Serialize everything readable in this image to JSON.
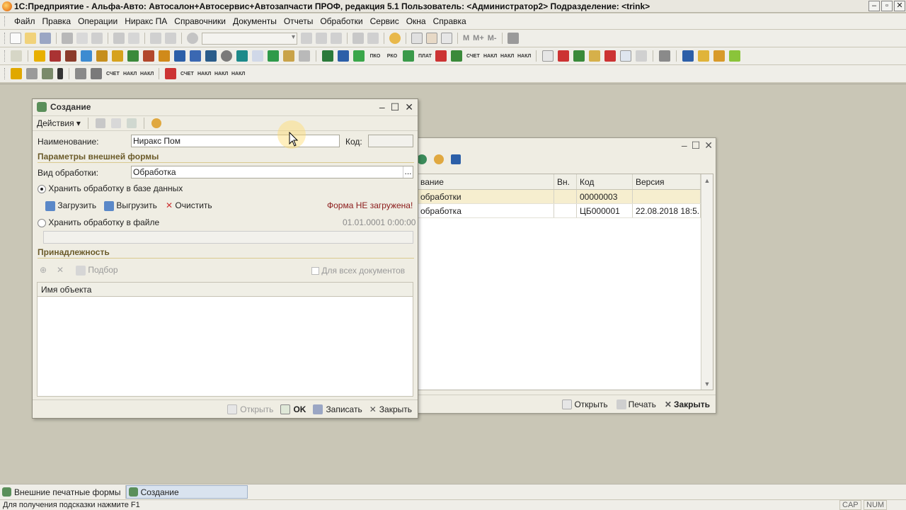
{
  "window": {
    "title": "1С:Предприятие - Альфа-Авто: Автосалон+Автосервис+Автозапчасти ПРОФ, редакция 5.1     Пользователь: <Администратор2>     Подразделение: <trink>"
  },
  "menu": [
    "Файл",
    "Правка",
    "Операции",
    "Ниракс ПА",
    "Справочники",
    "Документы",
    "Отчеты",
    "Обработки",
    "Сервис",
    "Окна",
    "Справка"
  ],
  "toolbar": {
    "m_labels": [
      "M",
      "M+",
      "M-"
    ],
    "doc_labels": [
      "ПКО",
      "РКО",
      "ПЛАТ",
      "СЧЕТ",
      "НАКЛ",
      "НАКЛ",
      "НАКЛ",
      "СЧЕТ",
      "НАКЛ",
      "НАКЛ",
      "НАКЛ"
    ]
  },
  "back_window": {
    "columns": [
      "вание",
      "Вн.",
      "Код",
      "Версия"
    ],
    "rows": [
      {
        "name": "обработки",
        "vn": "",
        "code": "00000003",
        "version": ""
      },
      {
        "name": "обработка",
        "vn": "",
        "code": "ЦБ000001",
        "version": "22.08.2018 18:5..."
      }
    ],
    "buttons": {
      "open": "Открыть",
      "print": "Печать",
      "close": "Закрыть"
    }
  },
  "dialog": {
    "title": "Создание",
    "actions": "Действия",
    "name_label": "Наименование:",
    "name_value": "Ниракс Пом",
    "code_label": "Код:",
    "code_value": "",
    "section_params": "Параметры внешней формы",
    "kind_label": "Вид обработки:",
    "kind_value": "Обработка",
    "radio_db": "Хранить обработку в базе данных",
    "load": "Загрузить",
    "unload": "Выгрузить",
    "clear": "Очистить",
    "form_status": "Форма НЕ загружена!",
    "radio_file": "Хранить обработку в файле",
    "file_date": "01.01.0001 0:00:00",
    "section_belong": "Принадлежность",
    "pick": "Подбор",
    "all_docs": "Для всех документов",
    "col_object": "Имя объекта",
    "buttons": {
      "open": "Открыть",
      "ok": "OK",
      "save": "Записать",
      "close": "Закрыть"
    }
  },
  "taskbar": [
    {
      "label": "Внешние печатные формы",
      "active": false
    },
    {
      "label": "Создание",
      "active": true
    }
  ],
  "status": {
    "hint": "Для получения подсказки нажмите F1",
    "cap": "CAP",
    "num": "NUM"
  }
}
